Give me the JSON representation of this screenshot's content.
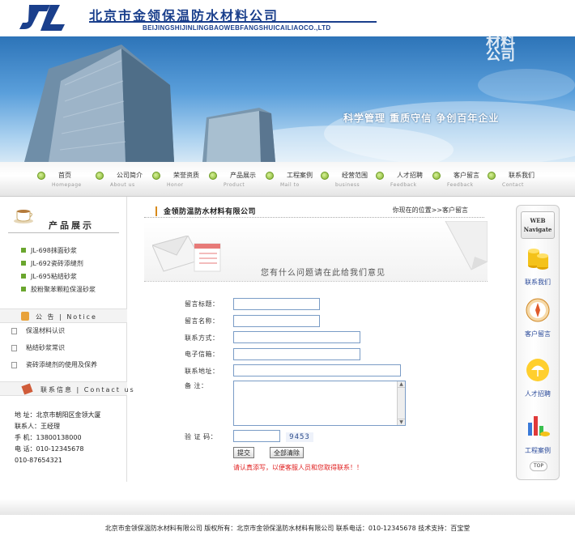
{
  "header": {
    "company_cn": "北京市金领保温防水材料公司",
    "company_en": "BEIJINGSHIJINLINGBAOWEBFANGSHUICAILIAOCO.,LTD",
    "logo_text": "JL"
  },
  "banner": {
    "slogan": "科学管理  重质守信  争创百年企业",
    "vertical_text": "材料公司"
  },
  "nav": [
    {
      "cn": "首页",
      "en": "Homepage"
    },
    {
      "cn": "公司简介",
      "en": "About us"
    },
    {
      "cn": "荣誉资质",
      "en": "Honor"
    },
    {
      "cn": "产品展示",
      "en": "Product"
    },
    {
      "cn": "工程案例",
      "en": "Mail to"
    },
    {
      "cn": "经营范围",
      "en": "business"
    },
    {
      "cn": "人才招聘",
      "en": "Feedback"
    },
    {
      "cn": "客户留言",
      "en": "Feedback"
    },
    {
      "cn": "联系我们",
      "en": "Contact"
    }
  ],
  "products": {
    "title": "产品展示",
    "items": [
      "JL-698抹面砂浆",
      "JL-692瓷砖添缝剂",
      "JL-695粘结砂浆",
      "胶粉聚苯颗粒保温砂浆"
    ]
  },
  "notice": {
    "title": "公 告 | Notice",
    "items": [
      "保温材料认识",
      "粘结砂浆常识",
      "瓷砖添缝剂的使用及保养"
    ]
  },
  "contact": {
    "title": "联系信息 | Contact us",
    "lines": [
      "地   址：北京市朝阳区金领大厦",
      "联系人：王经理",
      "手   机：13800138000",
      "电   话：010-12345678",
      "        010-87654321"
    ]
  },
  "main": {
    "title": "金领防温防水材料有限公司",
    "location": "你现在的位置>>客户留言",
    "prompt": "您有什么问题请在此给我们意见"
  },
  "form": {
    "labels": {
      "subject": "留言标题：",
      "name": "留言名称：",
      "contact": "联系方式：",
      "email": "电子信箱：",
      "address": "联系地址：",
      "remark": "备    注：",
      "captcha": "验 证 码："
    },
    "captcha_code": "9453",
    "submit_label": "提交",
    "reset_label": "全部清除",
    "note": "请认真添写，以便客服人员和您取得联系！！"
  },
  "right_nav": {
    "badge_line1": "WEB",
    "badge_line2": "Navigate",
    "items": [
      "联系我们",
      "客户留言",
      "人才招聘",
      "工程案例"
    ],
    "top_label": "TOP"
  },
  "footer": {
    "text": "北京市金领保温防水材料有限公司    版权所有：北京市金领保温防水材料有限公司  联系电话：010-12345678  技术支持：百宝堂"
  }
}
